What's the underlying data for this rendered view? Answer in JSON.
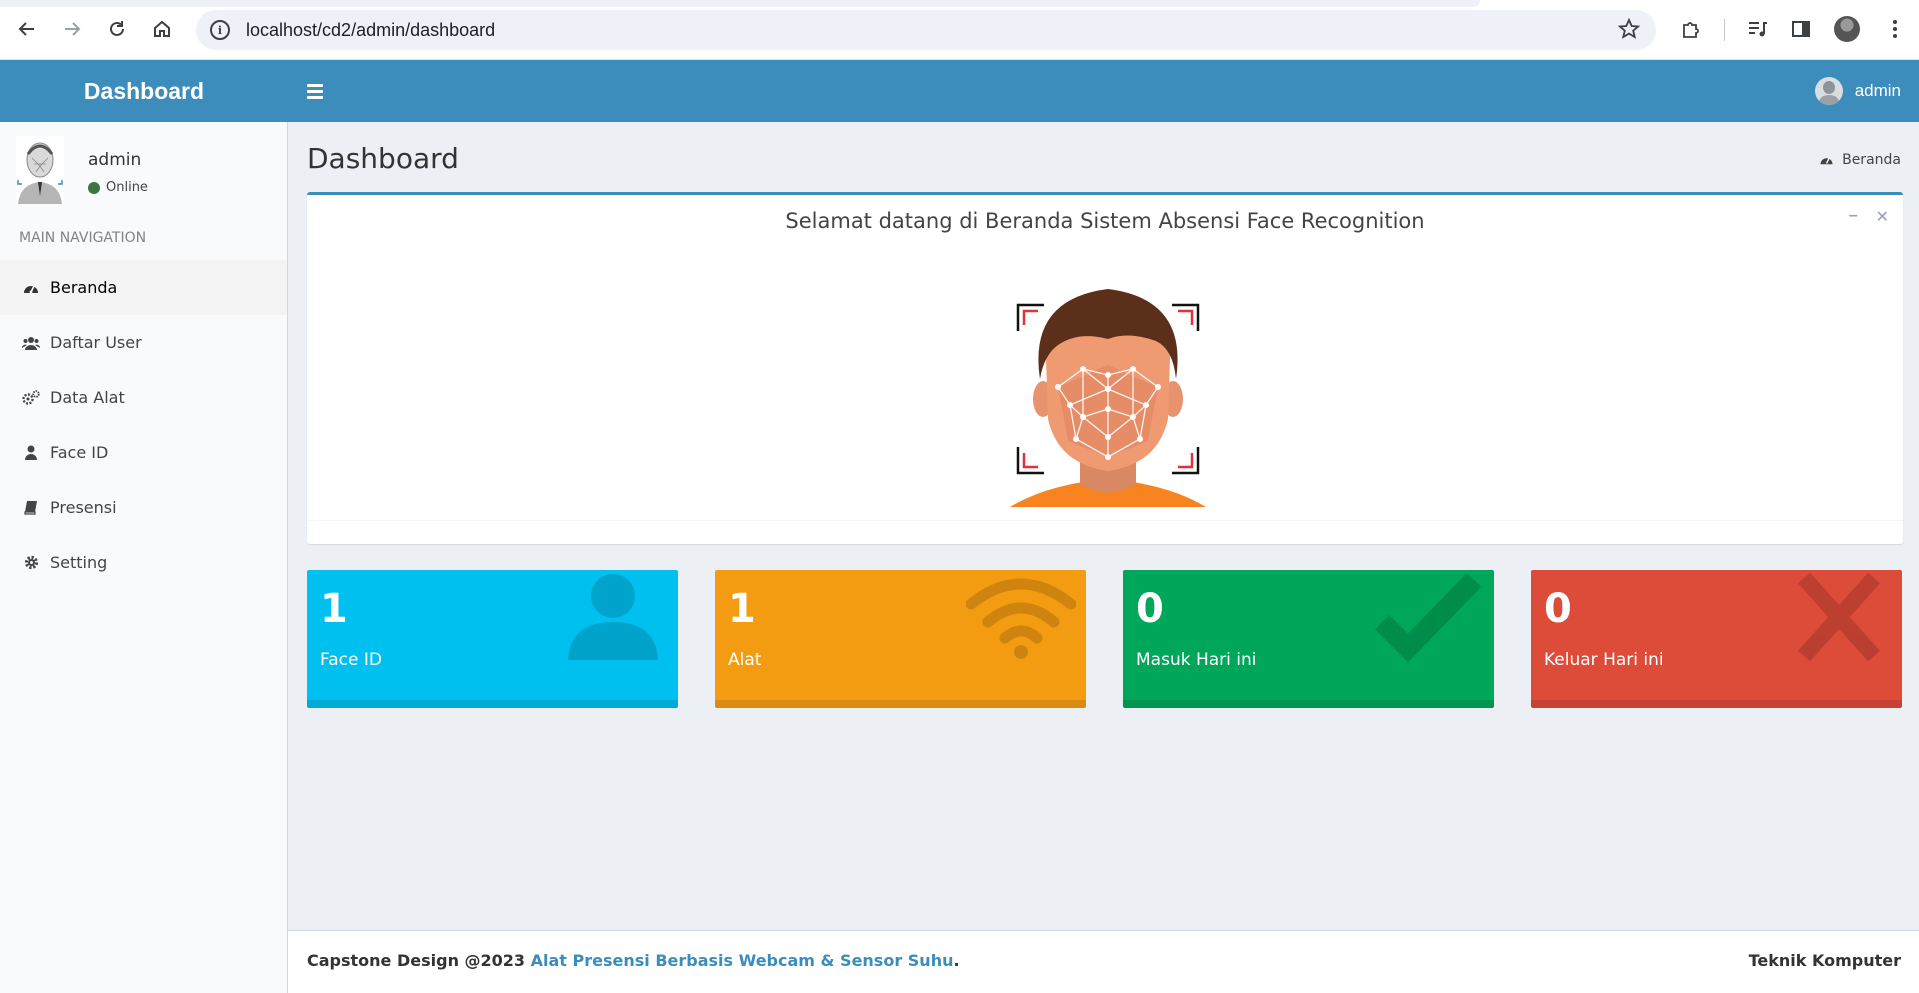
{
  "browser": {
    "url": "localhost/cd2/admin/dashboard",
    "icons": [
      "back-arrow-icon",
      "forward-arrow-icon",
      "reload-icon",
      "home-icon",
      "site-info-icon",
      "bookmark-star-icon",
      "extensions-icon",
      "media-control-icon",
      "side-panel-icon",
      "profile-avatar-icon",
      "more-menu-icon"
    ]
  },
  "header": {
    "logo": "Dashboard",
    "username": "admin",
    "color": "#3c8dbc"
  },
  "sidebar": {
    "user_name": "admin",
    "status": "Online",
    "nav_header": "MAIN NAVIGATION",
    "items": [
      {
        "label": "Beranda",
        "icon": "dashboard-icon",
        "active": true
      },
      {
        "label": "Daftar User",
        "icon": "users-icon"
      },
      {
        "label": "Data Alat",
        "icon": "cogs-icon"
      },
      {
        "label": "Face ID",
        "icon": "user-icon"
      },
      {
        "label": "Presensi",
        "icon": "book-icon"
      },
      {
        "label": "Setting",
        "icon": "gear-icon"
      }
    ]
  },
  "content": {
    "title": "Dashboard",
    "breadcrumb": "Beranda",
    "welcome": "Selamat datang di Beranda Sistem Absensi Face Recognition",
    "cards": [
      {
        "value": "1",
        "label": "Face ID",
        "color": "#00c0ef",
        "icon": "user-icon"
      },
      {
        "value": "1",
        "label": "Alat",
        "color": "#f39c12",
        "icon": "wifi-icon"
      },
      {
        "value": "0",
        "label": "Masuk Hari ini",
        "color": "#00a65a",
        "icon": "check-icon"
      },
      {
        "value": "0",
        "label": "Keluar Hari ini",
        "color": "#dd4b39",
        "icon": "x-icon"
      }
    ]
  },
  "footer": {
    "prefix": "Capstone Design @2023 ",
    "link": "Alat Presensi Berbasis Webcam & Sensor Suhu",
    "suffix": ".",
    "right": "Teknik Komputer"
  }
}
